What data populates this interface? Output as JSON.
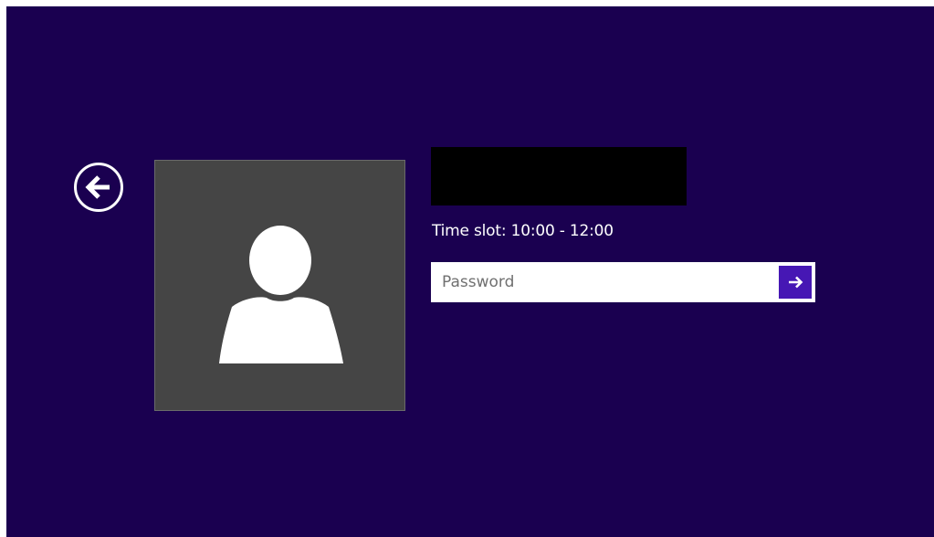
{
  "login": {
    "username": "",
    "time_slot": "Time slot: 10:00 - 12:00",
    "password_placeholder": "Password",
    "password_value": ""
  },
  "icons": {
    "back": "back-arrow-icon",
    "avatar": "user-silhouette-icon",
    "submit": "right-arrow-icon"
  },
  "colors": {
    "background": "#1a0050",
    "avatar_tile": "#454545",
    "submit_button": "#4617b4",
    "text": "#ffffff"
  }
}
